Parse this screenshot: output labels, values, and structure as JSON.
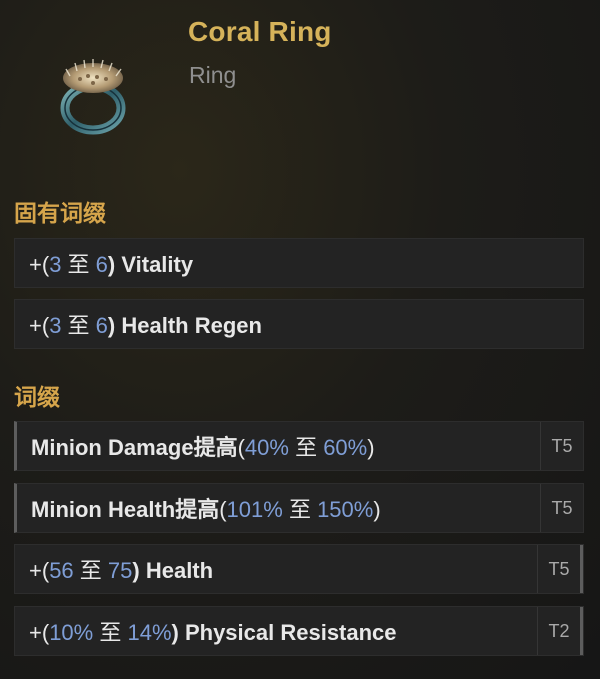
{
  "item": {
    "name": "Coral Ring",
    "type": "Ring",
    "icon": "coral-ring-icon"
  },
  "implicits": {
    "label": "固有词缀",
    "rows": [
      {
        "prefix": "+(",
        "min": "3",
        "mid": " 至 ",
        "max": "6",
        "suffix": ") Vitality"
      },
      {
        "prefix": "+(",
        "min": "3",
        "mid": " 至 ",
        "max": "6",
        "suffix": ") Health Regen"
      }
    ]
  },
  "affixes": {
    "label": "词缀",
    "rows": [
      {
        "lead": "Minion Damage提高",
        "prefix": "(",
        "min": "40%",
        "mid": " 至 ",
        "max": "60%",
        "suffix": ")",
        "tier": "T5"
      },
      {
        "lead": "Minion Health提高",
        "prefix": "(",
        "min": "101%",
        "mid": " 至 ",
        "max": "150%",
        "suffix": ")",
        "tier": "T5"
      },
      {
        "lead": "",
        "prefix": "+(",
        "min": "56",
        "mid": " 至 ",
        "max": "75",
        "suffix": ") Health",
        "tier": "T5"
      },
      {
        "lead": "",
        "prefix": "+(",
        "min": "10%",
        "mid": " 至 ",
        "max": "14%",
        "suffix": ") Physical Resistance",
        "tier": "T2"
      }
    ]
  },
  "colors": {
    "title": "#d6b35a",
    "section": "#d6a54b",
    "value": "#7f9ed6"
  }
}
